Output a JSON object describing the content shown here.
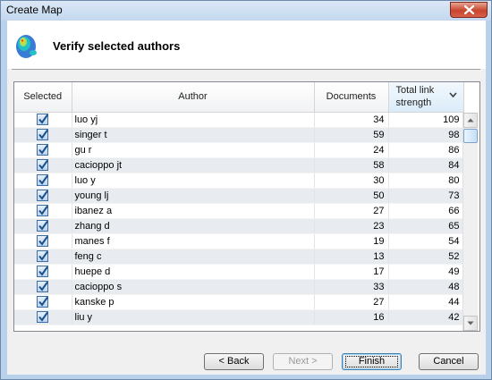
{
  "window": {
    "title": "Create Map"
  },
  "header": {
    "title": "Verify selected authors"
  },
  "table": {
    "columns": {
      "selected": "Selected",
      "author": "Author",
      "documents": "Documents",
      "strength_line1": "Total link",
      "strength_line2": "strength"
    },
    "rows": [
      {
        "author": "luo yj",
        "documents": "34",
        "strength": "109"
      },
      {
        "author": "singer t",
        "documents": "59",
        "strength": "98"
      },
      {
        "author": "gu r",
        "documents": "24",
        "strength": "86"
      },
      {
        "author": "cacioppo jt",
        "documents": "58",
        "strength": "84"
      },
      {
        "author": "luo y",
        "documents": "30",
        "strength": "80"
      },
      {
        "author": "young lj",
        "documents": "50",
        "strength": "73"
      },
      {
        "author": "ibanez a",
        "documents": "27",
        "strength": "66"
      },
      {
        "author": "zhang d",
        "documents": "23",
        "strength": "65"
      },
      {
        "author": "manes f",
        "documents": "19",
        "strength": "54"
      },
      {
        "author": "feng c",
        "documents": "13",
        "strength": "52"
      },
      {
        "author": "huepe d",
        "documents": "17",
        "strength": "49"
      },
      {
        "author": "cacioppo s",
        "documents": "33",
        "strength": "48"
      },
      {
        "author": "kanske p",
        "documents": "27",
        "strength": "44"
      },
      {
        "author": "liu y",
        "documents": "16",
        "strength": "42"
      }
    ]
  },
  "buttons": {
    "back": "< Back",
    "next": "Next >",
    "finish": "Finish",
    "cancel": "Cancel"
  },
  "colors": {
    "titlebar": "#c3d7ee",
    "close": "#c7452c",
    "row_alt": "#e8ecf1",
    "sort_header": "#dbecf9"
  }
}
